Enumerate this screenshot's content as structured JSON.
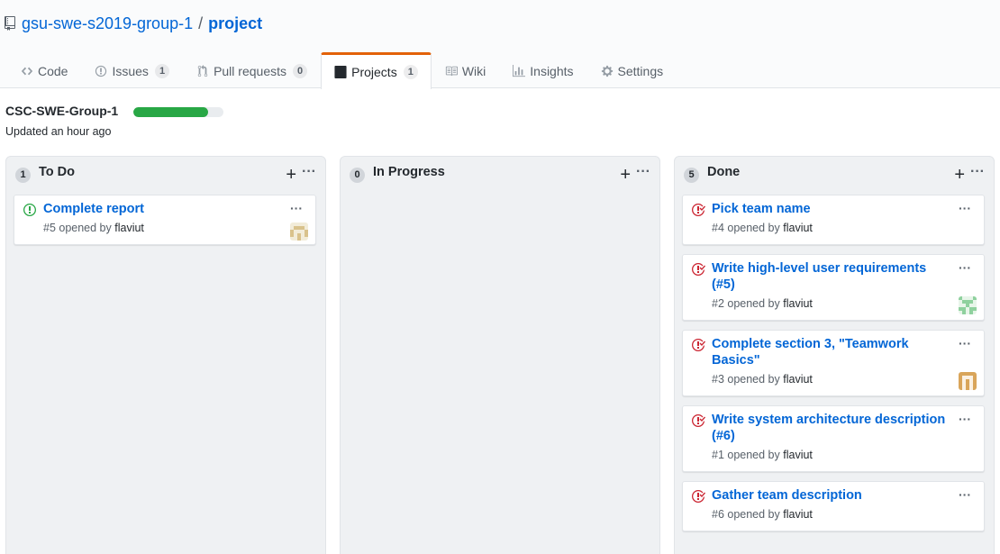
{
  "repo": {
    "owner": "gsu-swe-s2019-group-1",
    "separator": "/",
    "name": "project"
  },
  "tabs": [
    {
      "label": "Code",
      "icon": "code-icon"
    },
    {
      "label": "Issues",
      "icon": "issue-icon",
      "count": "1"
    },
    {
      "label": "Pull requests",
      "icon": "pull-request-icon",
      "count": "0"
    },
    {
      "label": "Projects",
      "icon": "project-icon",
      "count": "1",
      "selected": true
    },
    {
      "label": "Wiki",
      "icon": "book-icon"
    },
    {
      "label": "Insights",
      "icon": "graph-icon"
    },
    {
      "label": "Settings",
      "icon": "gear-icon"
    }
  ],
  "project": {
    "name": "CSC-SWE-Group-1",
    "updated": "Updated an hour ago",
    "progress_done_fraction": 0.83
  },
  "columns": [
    {
      "count": "1",
      "title": "To Do",
      "cards": [
        {
          "title": "Complete report",
          "meta": "#5 opened by",
          "author": "flaviut",
          "status": "open"
        }
      ]
    },
    {
      "count": "0",
      "title": "In Progress",
      "cards": []
    },
    {
      "count": "5",
      "title": "Done",
      "cards": [
        {
          "title": "Pick team name",
          "meta": "#4 opened by",
          "author": "flaviut",
          "status": "closed"
        },
        {
          "title": "Write high-level user requirements (#5)",
          "meta": "#2 opened by",
          "author": "flaviut",
          "status": "closed"
        },
        {
          "title": "Complete section 3, \"Teamwork Basics\"",
          "meta": "#3 opened by",
          "author": "flaviut",
          "status": "closed"
        },
        {
          "title": "Write system architecture description (#6)",
          "meta": "#1 opened by",
          "author": "flaviut",
          "status": "closed"
        },
        {
          "title": "Gather team description",
          "meta": "#6 opened by",
          "author": "flaviut",
          "status": "closed"
        }
      ]
    }
  ],
  "colors": {
    "accent": "#0366d6",
    "tab_active_border": "#e36209",
    "open": "#28a745",
    "closed": "#cb2431",
    "progress": "#28a745"
  }
}
